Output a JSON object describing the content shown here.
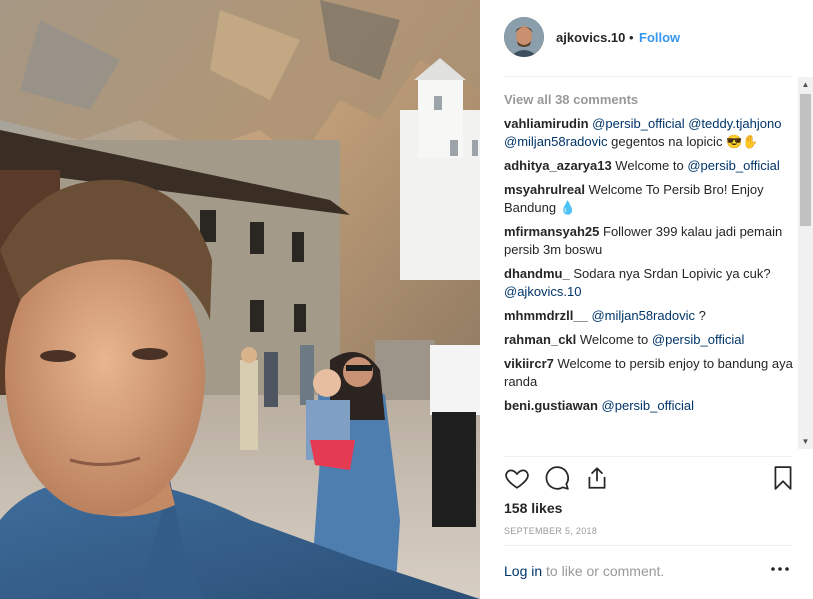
{
  "post": {
    "username": "ajkovics.10",
    "separator": "•",
    "follow_label": "Follow",
    "view_all_label": "View all 38 comments",
    "comments": [
      {
        "user": "vahliamirudin",
        "parts": [
          {
            "t": " "
          },
          {
            "m": "@persib_official"
          },
          {
            "t": " "
          },
          {
            "m": "@teddy.tjahjono"
          },
          {
            "t": " "
          },
          {
            "m": "@miljan58radovic"
          },
          {
            "t": " gegentos na lopicic 😎✋"
          }
        ]
      },
      {
        "user": "adhitya_azarya13",
        "parts": [
          {
            "t": " Welcome to "
          },
          {
            "m": "@persib_official"
          }
        ]
      },
      {
        "user": "msyahrulreal",
        "parts": [
          {
            "t": " Welcome To Persib Bro! Enjoy Bandung 💧"
          }
        ]
      },
      {
        "user": "mfirmansyah25",
        "parts": [
          {
            "t": " Follower 399 kalau jadi pemain persib 3m boswu"
          }
        ]
      },
      {
        "user": "dhandmu_",
        "parts": [
          {
            "t": " Sodara nya Srdan Lopivic ya cuk? "
          },
          {
            "m": "@ajkovics.10"
          }
        ]
      },
      {
        "user": "mhmmdrzll__",
        "parts": [
          {
            "t": " "
          },
          {
            "m": "@miljan58radovic"
          },
          {
            "t": " ?"
          }
        ]
      },
      {
        "user": "rahman_ckl",
        "parts": [
          {
            "t": " Welcome to "
          },
          {
            "m": "@persib_official"
          }
        ]
      },
      {
        "user": "vikiircr7",
        "parts": [
          {
            "t": " Welcome to persib enjoy to bandung aya randa"
          }
        ]
      },
      {
        "user": "beni.gustiawan",
        "parts": [
          {
            "t": " "
          },
          {
            "m": "@persib_official"
          }
        ]
      }
    ],
    "likes_label": "158 likes",
    "date_label": "SEPTEMBER 5, 2018",
    "login_label": "Log in",
    "login_suffix": " to like or comment.",
    "more_icon": "ellipsis-icon"
  },
  "icons": [
    "heart-icon",
    "comment-icon",
    "share-icon",
    "bookmark-icon"
  ],
  "colors": {
    "link": "#3897f0",
    "mention": "#003569",
    "muted": "#999999",
    "text": "#262626"
  }
}
